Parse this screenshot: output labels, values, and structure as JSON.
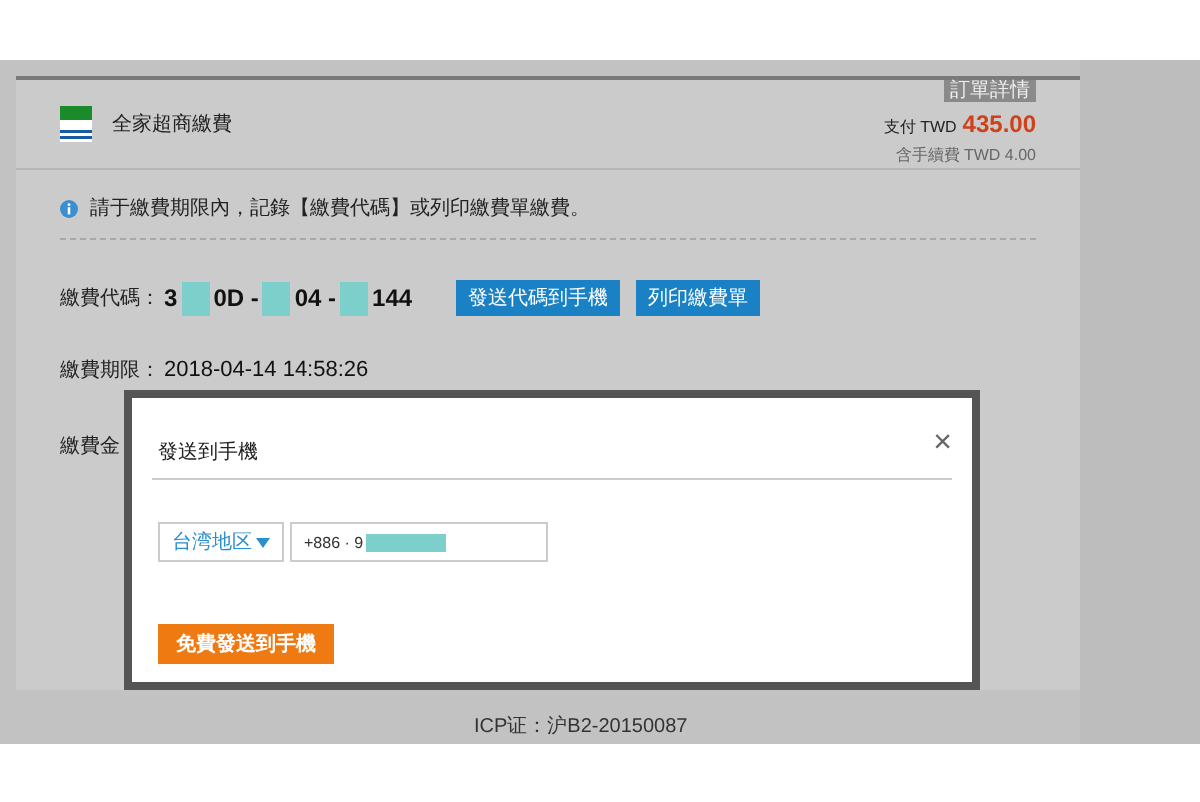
{
  "header": {
    "store_name": "全家超商繳費",
    "order_tag": "訂單詳情",
    "pay_label": "支付 TWD",
    "amount": "435.00",
    "fee_note": "含手續費 TWD 4.00"
  },
  "notice": "請于繳費期限內，記錄【繳費代碼】或列印繳費單繳費。",
  "code_row": {
    "label": "繳費代碼：",
    "parts": [
      {
        "kind": "text",
        "text": "3"
      },
      {
        "kind": "redacted"
      },
      {
        "kind": "text",
        "text": "0D -"
      },
      {
        "kind": "redacted"
      },
      {
        "kind": "text",
        "text": "04 -"
      },
      {
        "kind": "redacted"
      },
      {
        "kind": "text",
        "text": "144"
      }
    ],
    "buttons": [
      "發送代碼到手機",
      "列印繳費單"
    ]
  },
  "deadline": {
    "label": "繳費期限：",
    "value": "2018-04-14 14:58:26"
  },
  "amount_label": "繳費金",
  "modal": {
    "title": "發送到手機",
    "close": "×",
    "region": "台湾地区",
    "phone_parts": [
      {
        "kind": "text",
        "text": "+886 · 9"
      },
      {
        "kind": "redacted"
      }
    ],
    "submit": "免費發送到手機"
  },
  "footer": "ICP证：沪B2-20150087"
}
